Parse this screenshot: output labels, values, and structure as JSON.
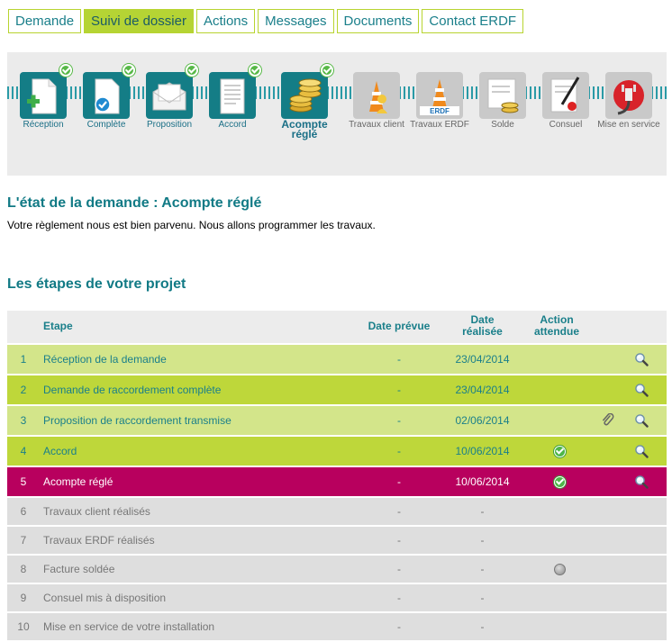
{
  "tabs": [
    {
      "label": "Demande"
    },
    {
      "label": "Suivi de dossier"
    },
    {
      "label": "Actions"
    },
    {
      "label": "Messages"
    },
    {
      "label": "Documents"
    },
    {
      "label": "Contact ERDF"
    }
  ],
  "active_tab": "Suivi de dossier",
  "steps": [
    {
      "label": "Réception",
      "icon": "document-plus-icon",
      "status": "done"
    },
    {
      "label": "Complète",
      "icon": "document-check-icon",
      "status": "done"
    },
    {
      "label": "Proposition",
      "icon": "envelope-icon",
      "status": "done"
    },
    {
      "label": "Accord",
      "icon": "contract-icon",
      "status": "done"
    },
    {
      "label": "Acompte réglé",
      "icon": "coins-icon",
      "status": "current"
    },
    {
      "label": "Travaux client",
      "icon": "traffic-cone-worker-icon",
      "status": "future"
    },
    {
      "label": "Travaux ERDF",
      "icon": "traffic-cone-erdf-icon",
      "status": "future"
    },
    {
      "label": "Solde",
      "icon": "invoice-coins-icon",
      "status": "future"
    },
    {
      "label": "Consuel",
      "icon": "certificate-pen-icon",
      "status": "future"
    },
    {
      "label": "Mise en service",
      "icon": "power-plug-icon",
      "status": "future"
    }
  ],
  "state": {
    "title": "L'état de la demande : Acompte réglé",
    "message": "Votre règlement nous est bien parvenu. Nous allons programmer les travaux."
  },
  "project": {
    "title": "Les étapes de votre projet",
    "columns": {
      "etape": "Etape",
      "date_prevue": "Date prévue",
      "date_realisee_1": "Date",
      "date_realisee_2": "réalisée",
      "action_1": "Action",
      "action_2": "attendue"
    },
    "rows": [
      {
        "num": "1",
        "label": "Réception de la demande",
        "prevue": "-",
        "realisee": "23/04/2014",
        "action": "",
        "clip": false,
        "zoom": true,
        "status": "done"
      },
      {
        "num": "2",
        "label": "Demande de raccordement complète",
        "prevue": "-",
        "realisee": "23/04/2014",
        "action": "",
        "clip": false,
        "zoom": true,
        "status": "done-alt"
      },
      {
        "num": "3",
        "label": "Proposition de raccordement transmise",
        "prevue": "-",
        "realisee": "02/06/2014",
        "action": "",
        "clip": true,
        "zoom": true,
        "status": "done"
      },
      {
        "num": "4",
        "label": "Accord",
        "prevue": "-",
        "realisee": "10/06/2014",
        "action": "check",
        "clip": false,
        "zoom": true,
        "status": "done-alt"
      },
      {
        "num": "5",
        "label": "Acompte réglé",
        "prevue": "-",
        "realisee": "10/06/2014",
        "action": "check",
        "clip": false,
        "zoom": true,
        "status": "current"
      },
      {
        "num": "6",
        "label": "Travaux client réalisés",
        "prevue": "-",
        "realisee": "-",
        "action": "",
        "clip": false,
        "zoom": false,
        "status": "todo"
      },
      {
        "num": "7",
        "label": "Travaux ERDF réalisés",
        "prevue": "-",
        "realisee": "-",
        "action": "",
        "clip": false,
        "zoom": false,
        "status": "todo"
      },
      {
        "num": "8",
        "label": "Facture soldée",
        "prevue": "-",
        "realisee": "-",
        "action": "pending",
        "clip": false,
        "zoom": false,
        "status": "todo"
      },
      {
        "num": "9",
        "label": "Consuel mis à disposition",
        "prevue": "-",
        "realisee": "-",
        "action": "",
        "clip": false,
        "zoom": false,
        "status": "todo"
      },
      {
        "num": "10",
        "label": "Mise en service de votre installation",
        "prevue": "-",
        "realisee": "-",
        "action": "",
        "clip": false,
        "zoom": false,
        "status": "todo"
      }
    ]
  },
  "colors": {
    "accent_teal": "#117a85",
    "tab_active_green": "#b5d434",
    "row_done_light": "#d3e58a",
    "row_done_dark": "#bed73a",
    "row_current_magenta": "#b8005e",
    "row_todo_grey": "#dedede"
  }
}
